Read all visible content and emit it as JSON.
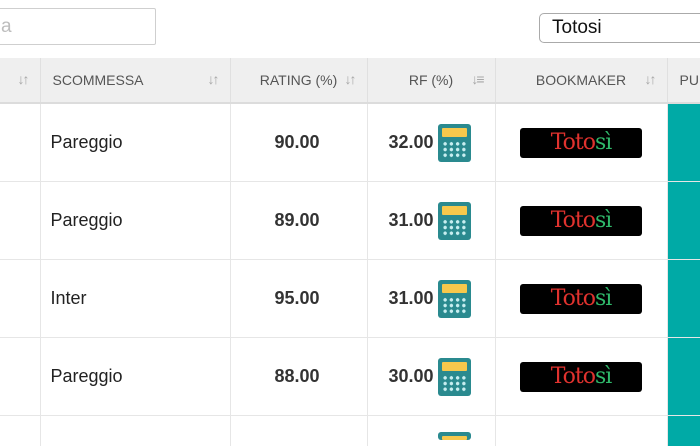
{
  "search": {
    "placeholder": "a"
  },
  "filter": {
    "selected": "Totosi"
  },
  "columns": {
    "scommessa": "SCOMMESSA",
    "rating": "RATING (%)",
    "rf": "RF (%)",
    "bookmaker": "BOOKMAKER",
    "pu": "PU"
  },
  "icons": {
    "sort": "sort-arrows-icon",
    "calculator": "calculator-icon"
  },
  "rows": [
    {
      "scommessa": "Pareggio",
      "rating": "90.00",
      "rf": "32.00",
      "bookmaker": {
        "left": "Toto",
        "right": "sì"
      }
    },
    {
      "scommessa": "Pareggio",
      "rating": "89.00",
      "rf": "31.00",
      "bookmaker": {
        "left": "Toto",
        "right": "sì"
      }
    },
    {
      "scommessa": "Inter",
      "rating": "95.00",
      "rf": "31.00",
      "bookmaker": {
        "left": "Toto",
        "right": "sì"
      }
    },
    {
      "scommessa": "Pareggio",
      "rating": "88.00",
      "rf": "30.00",
      "bookmaker": {
        "left": "Toto",
        "right": "sì"
      }
    }
  ],
  "colors": {
    "accent": "#00aaa6",
    "calculator": "#2a8a8f",
    "header_bg": "#efefef"
  }
}
